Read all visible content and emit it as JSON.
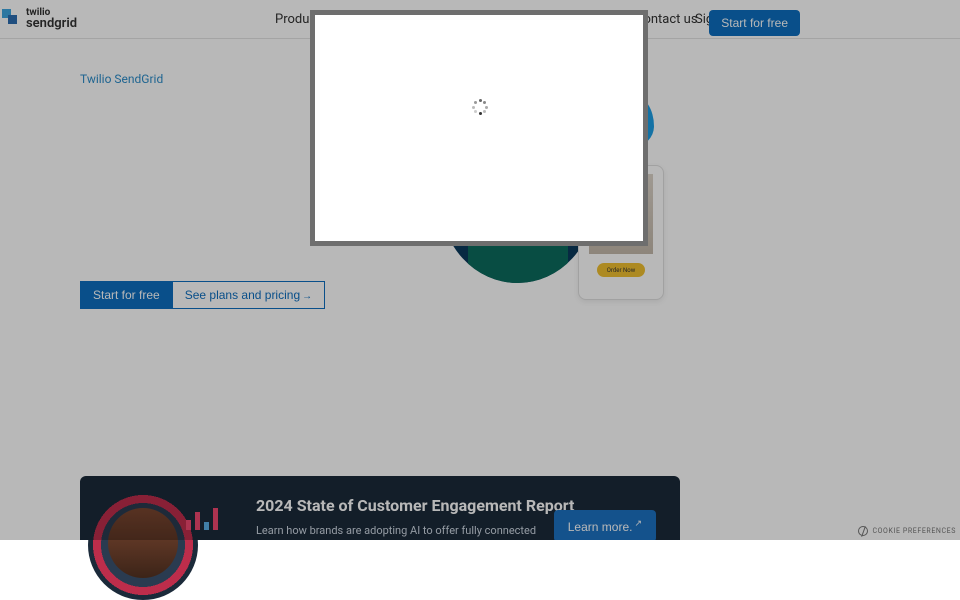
{
  "brand": {
    "top": "twilio",
    "bottom": "sendgrid"
  },
  "nav": {
    "products": "Products",
    "contact": "Contact us",
    "signin": "Sign in",
    "start": "Start for free"
  },
  "breadcrumb": "Twilio SendGrid",
  "hero": {
    "cta_primary": "Start for free",
    "cta_secondary": "See plans and pricing",
    "card_btn": "Order Now"
  },
  "banner": {
    "title": "2024 State of Customer Engagement Report",
    "desc": "Learn how brands are adopting AI to offer fully connected experiences and how customers are responding.",
    "cta": "Learn more."
  },
  "footer": {
    "cookie": "COOKIE PREFERENCES"
  }
}
